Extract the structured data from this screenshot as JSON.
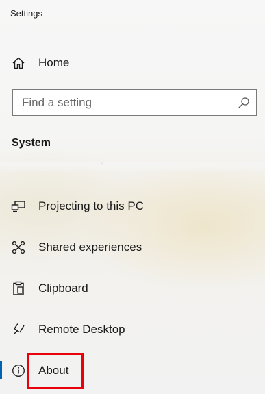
{
  "app": {
    "title": "Settings"
  },
  "nav": {
    "home": {
      "label": "Home",
      "icon": "home-icon"
    },
    "search": {
      "placeholder": "Find a setting",
      "icon": "search-icon"
    },
    "section_heading": "System",
    "items": [
      {
        "label": "Projecting to this PC",
        "icon": "projector-icon"
      },
      {
        "label": "Shared experiences",
        "icon": "shared-experiences-icon"
      },
      {
        "label": "Clipboard",
        "icon": "clipboard-icon"
      },
      {
        "label": "Remote Desktop",
        "icon": "remote-desktop-icon"
      },
      {
        "label": "About",
        "icon": "info-icon",
        "selected": true
      }
    ]
  },
  "colors": {
    "accent": "#0063b1",
    "highlight": "#e8000b"
  }
}
